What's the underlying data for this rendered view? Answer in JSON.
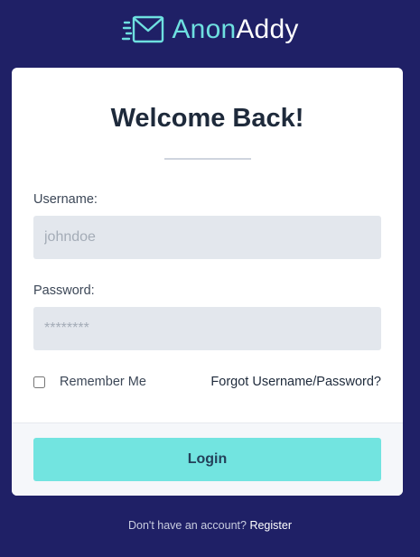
{
  "brand": {
    "name_part1": "Anon",
    "name_part2": "Addy",
    "icon": "envelope-icon",
    "accent_color": "#6ee0e0",
    "background_color": "#1f2066"
  },
  "login_card": {
    "title": "Welcome Back!",
    "username": {
      "label": "Username:",
      "value": "",
      "placeholder": "johndoe"
    },
    "password": {
      "label": "Password:",
      "value": "",
      "placeholder": "********"
    },
    "remember_me": {
      "label": "Remember Me",
      "checked": false
    },
    "forgot_link": "Forgot Username/Password?",
    "login_button": "Login",
    "login_button_color": "#72e4e0"
  },
  "footer": {
    "prompt": "Don't have an account?",
    "register_link": "Register"
  }
}
